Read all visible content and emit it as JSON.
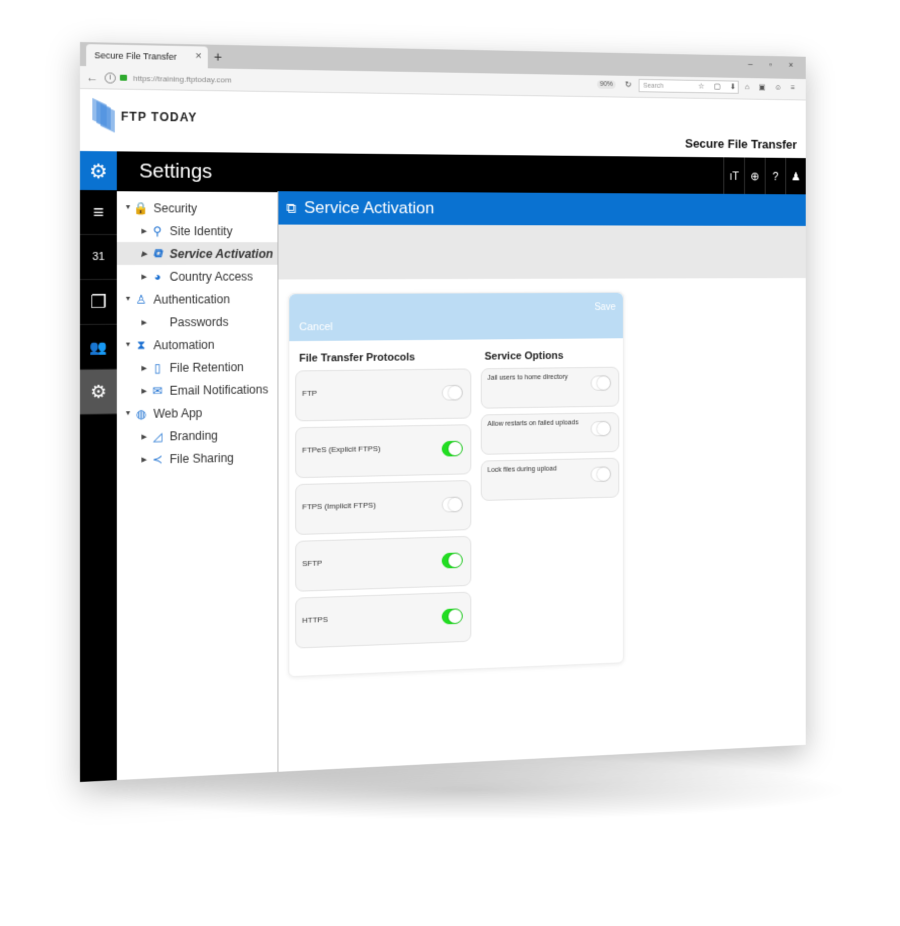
{
  "browser": {
    "tab_title": "Secure File Transfer",
    "tab_close": "×",
    "new_tab": "+",
    "window_controls": "– ▫ ×",
    "back": "←",
    "info": "i",
    "url": "https://training.ftptoday.com",
    "zoom_level": "90%",
    "reload": "↻",
    "search_placeholder": "Search",
    "toolbar_icons": "☆ ▢ ⬇ ⌂ ▣ ☺ ≡"
  },
  "header": {
    "logo_text": "FTP TODAY",
    "brand": "Secure File Transfer"
  },
  "settings_bar": {
    "gear": "⚙",
    "title": "Settings",
    "icons": [
      "ıT",
      "⊕",
      "?",
      "♟"
    ]
  },
  "rail": [
    "≡",
    "31",
    "❐",
    "👥",
    "⚙"
  ],
  "tree": [
    {
      "label": "Security",
      "icon": "🔒",
      "level": 0,
      "twisty": "▼"
    },
    {
      "label": "Site Identity",
      "icon": "⚲",
      "level": 1,
      "twisty": "▶"
    },
    {
      "label": "Service Activation",
      "icon": "⧉",
      "level": 1,
      "twisty": "▶",
      "selected": true
    },
    {
      "label": "Country Access",
      "icon": "◕",
      "level": 1,
      "twisty": "▶"
    },
    {
      "label": "Authentication",
      "icon": "♙",
      "level": 0,
      "twisty": "▼"
    },
    {
      "label": "Passwords",
      "icon": "",
      "level": 1,
      "twisty": "▶"
    },
    {
      "label": "Automation",
      "icon": "⧗",
      "level": 0,
      "twisty": "▼"
    },
    {
      "label": "File Retention",
      "icon": "▯",
      "level": 1,
      "twisty": "▶"
    },
    {
      "label": "Email Notifications",
      "icon": "✉",
      "level": 1,
      "twisty": "▶"
    },
    {
      "label": "Web App",
      "icon": "◍",
      "level": 0,
      "twisty": "▼"
    },
    {
      "label": "Branding",
      "icon": "◿",
      "level": 1,
      "twisty": "▶"
    },
    {
      "label": "File Sharing",
      "icon": "≺",
      "level": 1,
      "twisty": "▶"
    }
  ],
  "main": {
    "title_icon": "⧉",
    "title": "Service Activation",
    "cancel_label": "Cancel",
    "save_label": "Save",
    "protocols_heading": "File Transfer Protocols",
    "protocols": [
      {
        "label": "FTP",
        "enabled": false
      },
      {
        "label": "FTPeS (Explicit FTPS)",
        "enabled": true
      },
      {
        "label": "FTPS (Implicit FTPS)",
        "enabled": false
      },
      {
        "label": "SFTP",
        "enabled": true
      },
      {
        "label": "HTTPS",
        "enabled": true
      }
    ],
    "options_heading": "Service Options",
    "options": [
      {
        "label": "Jail users to home directory",
        "enabled": false
      },
      {
        "label": "Allow restarts on failed uploads",
        "enabled": false
      },
      {
        "label": "Lock files during upload",
        "enabled": false
      }
    ]
  },
  "colors": {
    "accent": "#0a72d1",
    "toggle_on": "#22dd22",
    "card_bar": "#bcdcf4"
  }
}
